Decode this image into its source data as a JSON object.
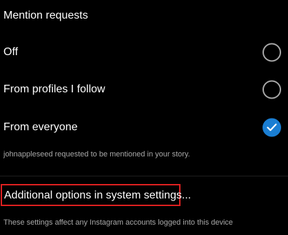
{
  "section": {
    "title": "Mention requests"
  },
  "options": [
    {
      "label": "Off",
      "selected": false
    },
    {
      "label": "From profiles I follow",
      "selected": false
    },
    {
      "label": "From everyone",
      "selected": true
    }
  ],
  "caption": "johnappleseed requested to be mentioned in your story.",
  "system_settings": {
    "label": "Additional options in system settings..."
  },
  "footer": {
    "note": "These settings affect any Instagram accounts logged into this device"
  },
  "colors": {
    "background": "#000000",
    "accent": "#1a7ed3",
    "highlight_border": "#e02020",
    "secondary_text": "#a8a8a8"
  }
}
